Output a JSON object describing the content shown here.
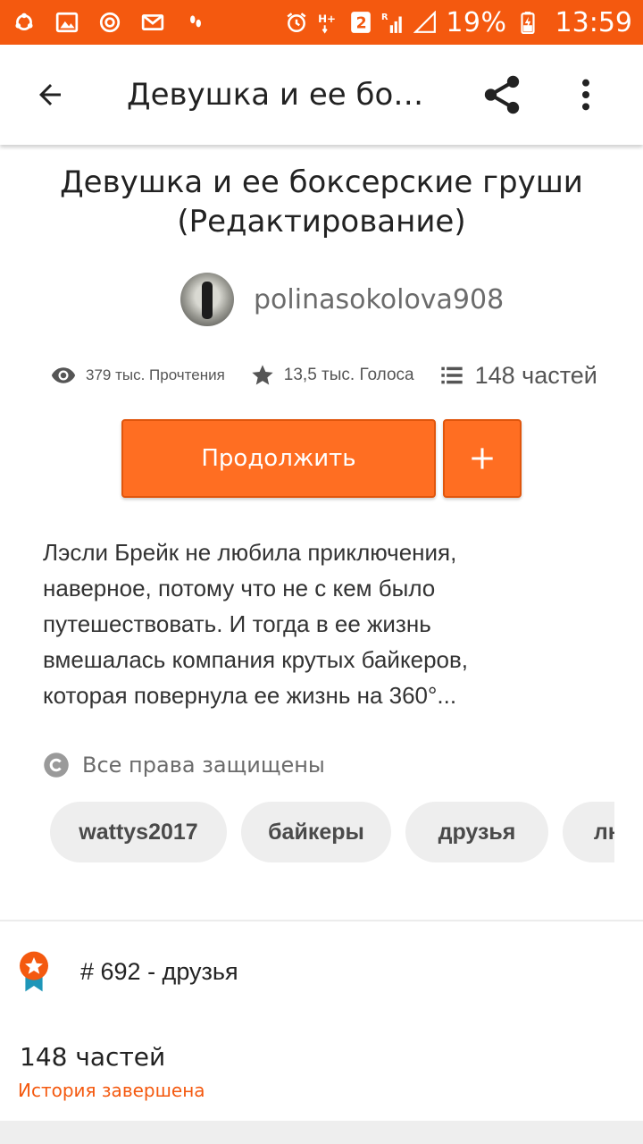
{
  "status_bar": {
    "battery": "19%",
    "time": "13:59",
    "sim_badge": "2",
    "network": "H+",
    "colors": {
      "background": "#f4590f"
    }
  },
  "app_bar": {
    "title": "Девушка и ее бокс...",
    "icons": [
      "back-arrow-icon",
      "share-icon",
      "more-vert-icon"
    ]
  },
  "story": {
    "title": "Девушка и ее боксерские груши (Редактирование)",
    "author": "polinasokolova908",
    "stats": {
      "reads": "379 тыс. Прочтения",
      "votes": "13,5 тыс. Голоса",
      "parts": "148 частей"
    },
    "continue_label": "Продолжить",
    "add_label": "+",
    "description": "Лэсли Брейк не любила приключения,\nнаверное, потому что не с кем  было\nпутешествовать. И тогда в ее жизнь\nвмешалась компания крутых байкеров,\nкоторая повернула ее жизнь на 360°...",
    "copyright": "Все права защищены",
    "tags": [
      "wattys2017",
      "байкеры",
      "друзья",
      "любовь"
    ],
    "ranking": "# 692 - друзья",
    "parts_count": "148 частей",
    "parts_status": "История завершена",
    "accent_color": "#ff6e22"
  }
}
